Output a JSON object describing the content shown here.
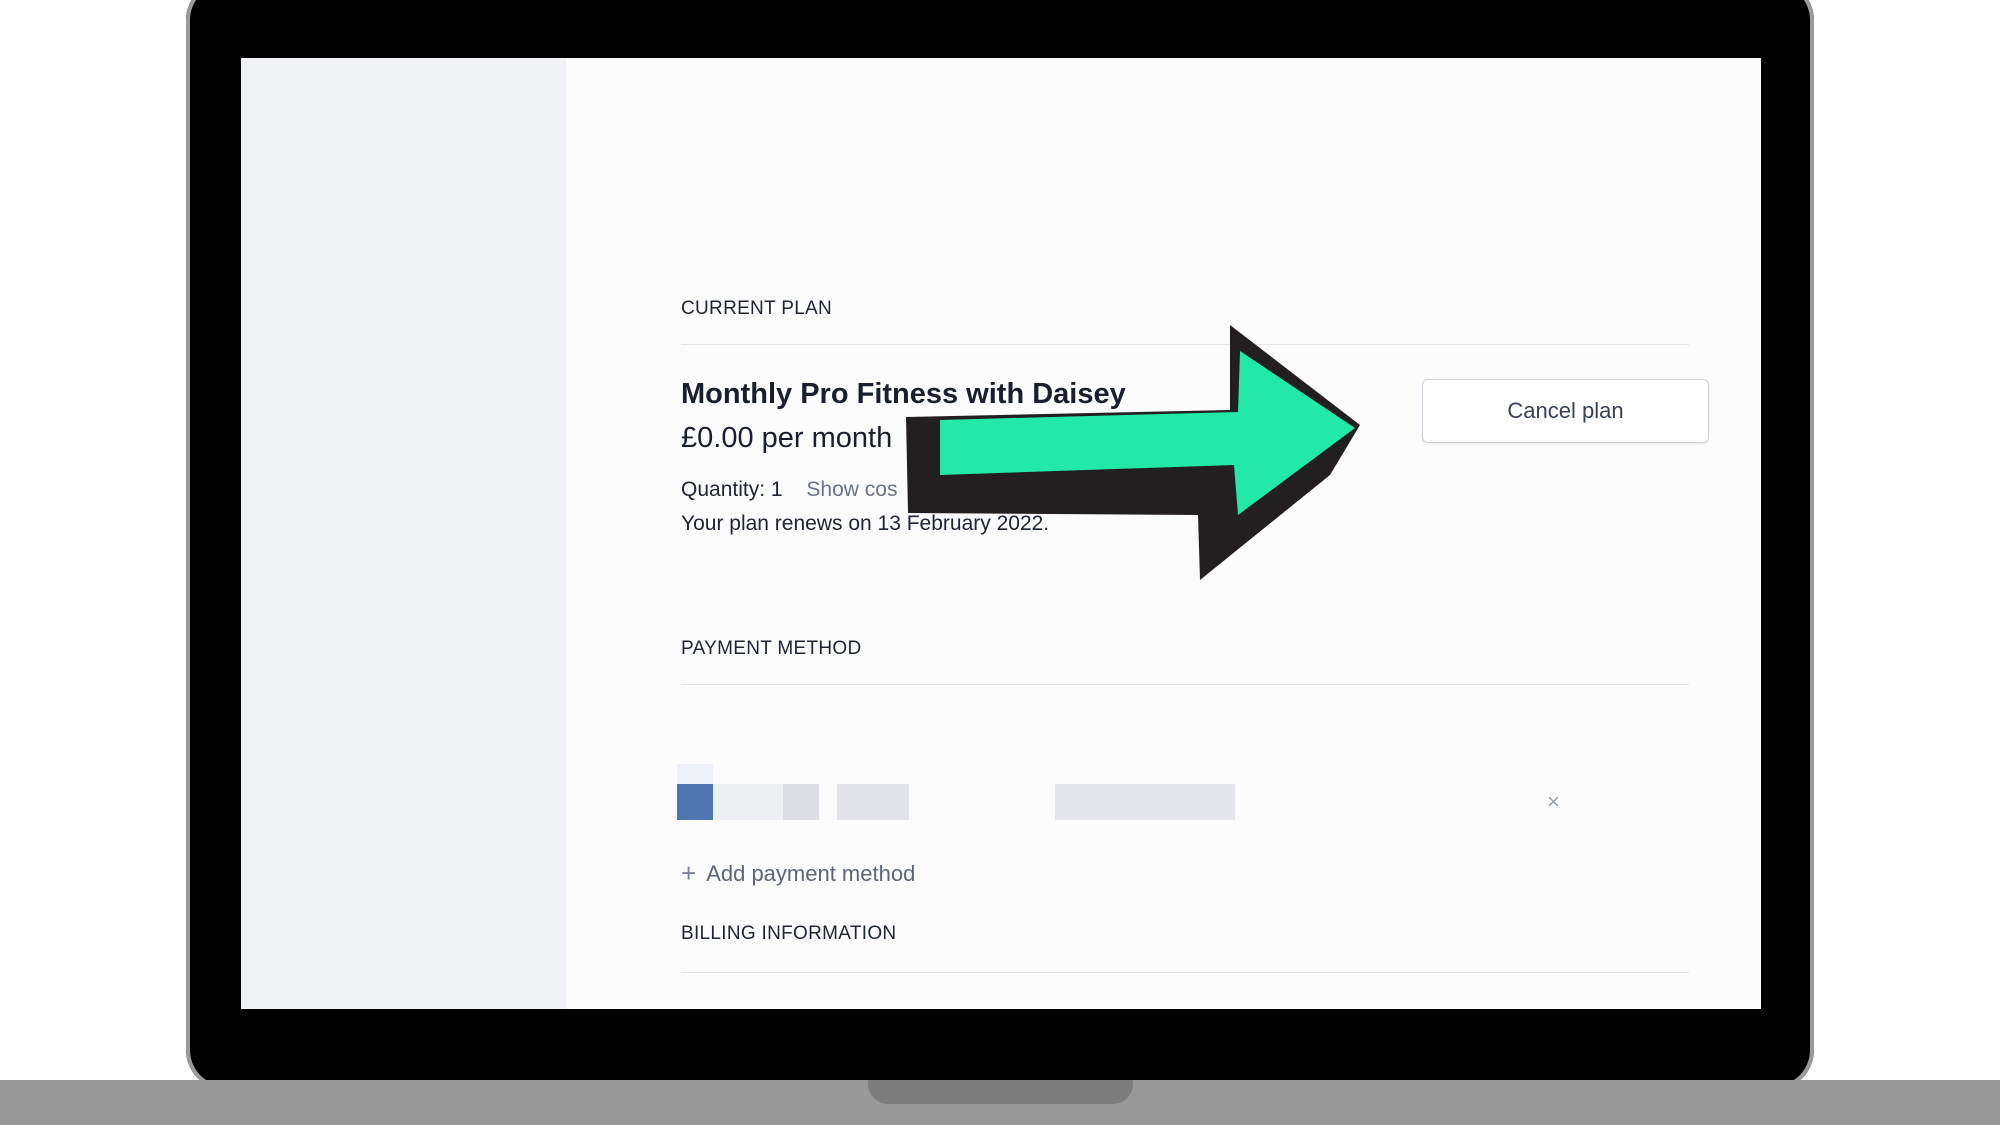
{
  "sections": {
    "current_plan": "CURRENT PLAN",
    "payment_method": "PAYMENT METHOD",
    "billing_information": "BILLING INFORMATION"
  },
  "plan": {
    "name": "Monthly Pro Fitness with Daisey",
    "price": "£0.00 per month",
    "quantity": "Quantity: 1",
    "show_cost_link": "Show cos",
    "renewal": "Your plan renews on 13 February 2022."
  },
  "buttons": {
    "cancel_plan": "Cancel plan",
    "add_payment_method": "Add payment method",
    "remove_icon": "×",
    "add_icon": "+"
  },
  "icons": {
    "arrow": "green-pointer-arrow",
    "remove": "close-icon",
    "add": "plus-icon"
  },
  "colors": {
    "arrow_fill": "#22e8a8",
    "arrow_outline": "#231f20",
    "card_logo": "#4f75b3"
  }
}
